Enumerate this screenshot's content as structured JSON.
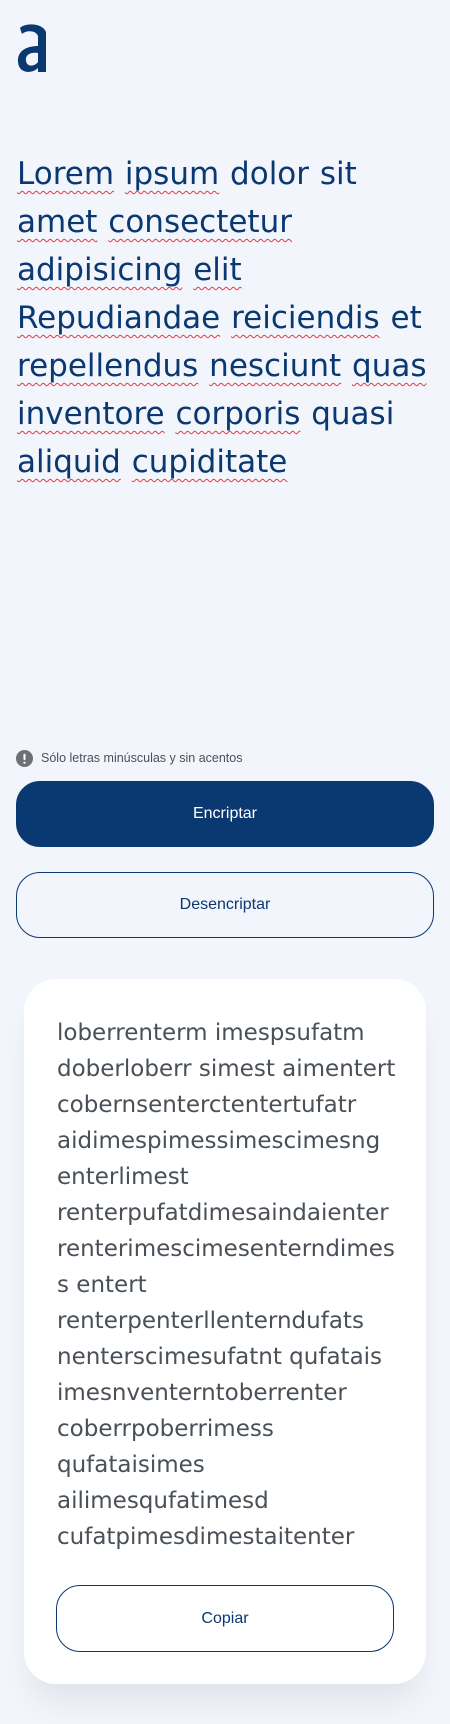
{
  "colors": {
    "background": "#f3f5fc",
    "primary": "#0a3871",
    "text_secondary": "#495057",
    "card": "#ffffff"
  },
  "logo": {
    "icon": "alura-a-logo-icon"
  },
  "input": {
    "words": [
      "Lorem",
      "ipsum",
      "dolor",
      "sit",
      "amet",
      "consectetur",
      "adipisicing",
      "elit",
      "Repudiandae",
      "reiciendis",
      "et",
      "repellendus",
      "nesciunt",
      "quas",
      "inventore",
      "corporis",
      "quasi",
      "aliquid",
      "cupiditate"
    ]
  },
  "hint": {
    "icon": "exclamation-circle-icon",
    "text": "Sólo letras minúsculas y sin acentos"
  },
  "buttons": {
    "encrypt_label": "Encriptar",
    "decrypt_label": "Desencriptar",
    "copy_label": "Copiar"
  },
  "output": {
    "lines": [
      "loberrenterm imespsufatm",
      "doberloberr simest aimentert",
      "cobernsenterctentertufatr",
      "aidimespimessimescimesng",
      "enterlimest",
      "renterpufatdimesaindaienter",
      "renterimescimesenterndimes",
      "s entert",
      "renterpenterllenterndufats",
      "nenterscimesufatnt qufatais",
      "imesnventerntoberrenter",
      "coberrpoberrimess",
      "qufataisimes",
      "ailimesqufatimesd",
      "cufatpimesdimestaitenter"
    ]
  }
}
